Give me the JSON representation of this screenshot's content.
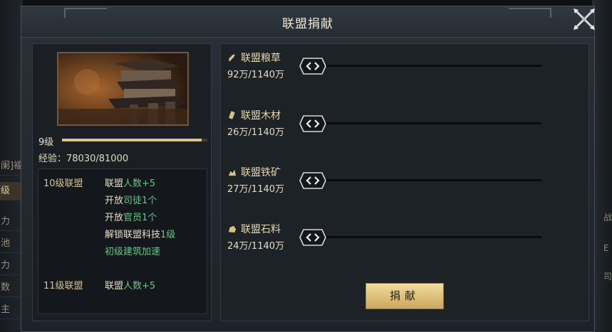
{
  "dialog": {
    "title": "联盟捐献"
  },
  "background": {
    "left_tabs": [
      "阑]福",
      "级",
      "力",
      "池",
      "力",
      "数",
      "主"
    ],
    "right_tabs": [
      "战",
      "E",
      "司"
    ]
  },
  "alliance": {
    "level_label": "9级",
    "level_progress": 0.963,
    "exp_label": "经验：",
    "exp_value": "78030/81000"
  },
  "upgrades": [
    {
      "level": "10级联盟",
      "lines": [
        {
          "prefix": "联盟",
          "highlight": "人数+5",
          "suffix": ""
        },
        {
          "prefix": "开放",
          "highlight": "司徒1个",
          "suffix": ""
        },
        {
          "prefix": "开放",
          "highlight": "官员1个",
          "suffix": ""
        },
        {
          "prefix": "解锁联盟科技",
          "highlight": "1级",
          "suffix": ""
        },
        {
          "prefix": "",
          "highlight": "初级建筑加速",
          "suffix": ""
        }
      ]
    },
    {
      "level": "11级联盟",
      "lines": [
        {
          "prefix": "联盟",
          "highlight": "人数+5",
          "suffix": ""
        }
      ]
    }
  ],
  "resources": [
    {
      "name": "联盟粮草",
      "amount": "92万/1140万",
      "icon": "grain-icon",
      "donate_value": 0
    },
    {
      "name": "联盟木材",
      "amount": "26万/1140万",
      "icon": "wood-icon",
      "donate_value": 0
    },
    {
      "name": "联盟铁矿",
      "amount": "27万/1140万",
      "icon": "iron-ore-icon",
      "donate_value": 0
    },
    {
      "name": "联盟石料",
      "amount": "24万/1140万",
      "icon": "stone-icon",
      "donate_value": 0
    }
  ],
  "donate_button": "捐献",
  "colors": {
    "accent_gold": "#d9c38e",
    "highlight_green": "#6ec28a",
    "button_gold": "#e6cc8a"
  }
}
